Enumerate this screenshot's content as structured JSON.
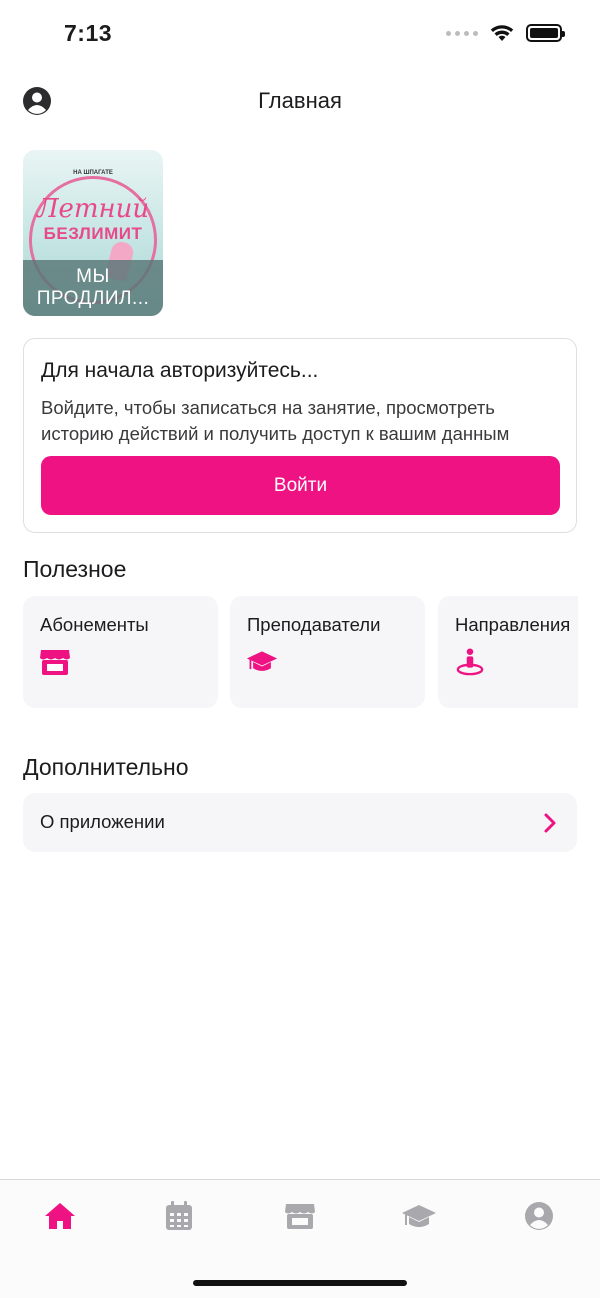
{
  "status_bar": {
    "time": "7:13"
  },
  "header": {
    "title": "Главная"
  },
  "story": {
    "logo_text": "НА ШПАГАТЕ",
    "script_text": "Летний",
    "bold_text": "БЕЗЛИМИТ",
    "caption": "МЫ ПРОДЛИЛ..."
  },
  "auth": {
    "title": "Для начала авторизуйтесь...",
    "text": "Войдите, чтобы записаться на занятие, просмотреть историю действий и получить доступ к вашим данным",
    "button_label": "Войти"
  },
  "useful": {
    "title": "Полезное",
    "items": [
      {
        "label": "Абонементы",
        "icon": "store-icon"
      },
      {
        "label": "Преподаватели",
        "icon": "graduation-cap-icon"
      },
      {
        "label": "Направления",
        "icon": "person-pin-icon"
      }
    ]
  },
  "extra": {
    "title": "Дополнительно",
    "items": [
      {
        "label": "О приложении",
        "icon": "chevron-right-icon"
      }
    ]
  },
  "tab_bar": {
    "tabs": [
      {
        "icon": "home-icon",
        "active": true
      },
      {
        "icon": "calendar-icon",
        "active": false
      },
      {
        "icon": "store-icon",
        "active": false
      },
      {
        "icon": "graduation-cap-icon",
        "active": false
      },
      {
        "icon": "profile-icon",
        "active": false
      }
    ]
  },
  "colors": {
    "accent": "#ee1283",
    "inactive_icon": "#a8a8ad",
    "card_background": "#f6f6f9"
  }
}
